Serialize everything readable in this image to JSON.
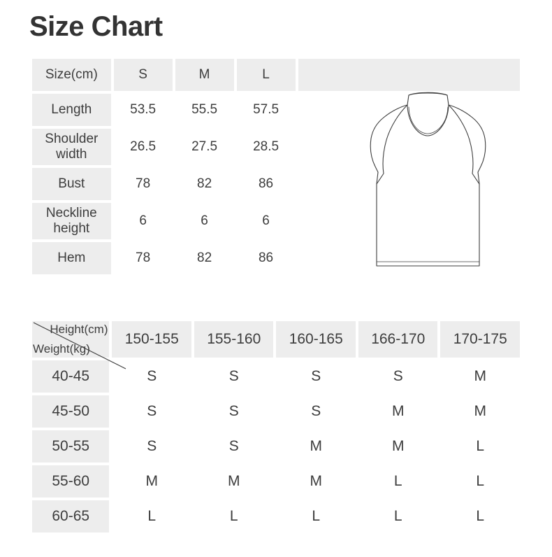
{
  "page": {
    "title": "Size Chart",
    "background_color": "#ffffff",
    "cell_shade_color": "#ededed",
    "text_color": "#3d3d3d"
  },
  "measurement_table": {
    "header": {
      "label": "Size(cm)",
      "sizes": [
        "S",
        "M",
        "L"
      ],
      "spacer": ""
    },
    "rows": [
      {
        "label": "Length",
        "values": [
          "53.5",
          "55.5",
          "57.5"
        ]
      },
      {
        "label": "Shoulder width",
        "values": [
          "26.5",
          "27.5",
          "28.5"
        ]
      },
      {
        "label": "Bust",
        "values": [
          "78",
          "82",
          "86"
        ]
      },
      {
        "label": "Neckline height",
        "values": [
          "6",
          "6",
          "6"
        ]
      },
      {
        "label": "Hem",
        "values": [
          "78",
          "82",
          "86"
        ]
      }
    ]
  },
  "garment": {
    "icon_name": "sleeveless-mock-neck-top-illustration",
    "stroke_color": "#3d3d3d"
  },
  "fit_table": {
    "corner": {
      "height_label": "Height(cm)",
      "weight_label": "Weight(kg)"
    },
    "height_ranges": [
      "150-155",
      "155-160",
      "160-165",
      "166-170",
      "170-175"
    ],
    "rows": [
      {
        "weight": "40-45",
        "sizes": [
          "S",
          "S",
          "S",
          "S",
          "M"
        ]
      },
      {
        "weight": "45-50",
        "sizes": [
          "S",
          "S",
          "S",
          "M",
          "M"
        ]
      },
      {
        "weight": "50-55",
        "sizes": [
          "S",
          "S",
          "M",
          "M",
          "L"
        ]
      },
      {
        "weight": "55-60",
        "sizes": [
          "M",
          "M",
          "M",
          "L",
          "L"
        ]
      },
      {
        "weight": "60-65",
        "sizes": [
          "L",
          "L",
          "L",
          "L",
          "L"
        ]
      }
    ]
  }
}
